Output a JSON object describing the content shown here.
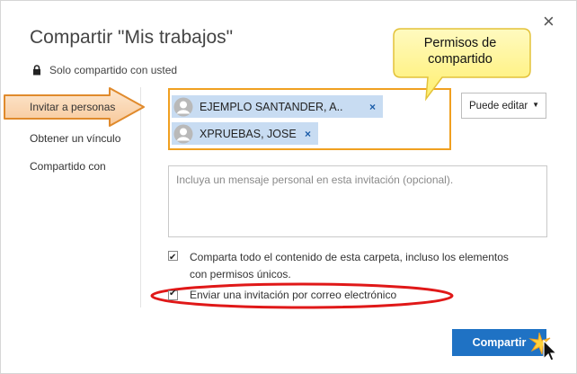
{
  "dialog": {
    "title": "Compartir \"Mis trabajos\"",
    "close_symbol": "×",
    "shared_status": "Solo compartido con usted"
  },
  "nav": {
    "items": [
      {
        "label": "Invitar a personas",
        "active": true
      },
      {
        "label": "Obtener un vínculo",
        "active": false
      },
      {
        "label": "Compartido con",
        "active": false
      }
    ]
  },
  "recipients": [
    {
      "name": "EJEMPLO SANTANDER, A..",
      "remove": "×"
    },
    {
      "name": "XPRUEBAS, JOSE",
      "remove": "×"
    }
  ],
  "permission": {
    "selected": "Puede editar",
    "arrow": "▼"
  },
  "message": {
    "placeholder": "Incluya un mensaje personal en esta invitación (opcional)."
  },
  "options": {
    "share_all": {
      "label": "Comparta todo el contenido de esta carpeta, incluso los elementos con permisos únicos.",
      "checked": true
    },
    "send_email": {
      "label": "Enviar una invitación por correo electrónico",
      "checked": true
    }
  },
  "share_button": {
    "label": "Compartir"
  },
  "callout": {
    "text": "Permisos de compartido"
  },
  "colors": {
    "accent": "#1f72c4",
    "chip": "#c8dcf2",
    "highlight_orange": "#f0a020",
    "highlight_red": "#e01818",
    "callout_fill": "#fff59a"
  },
  "icons": [
    "lock-icon",
    "avatar-icon",
    "remove-icon",
    "close-icon",
    "dropdown-arrow-icon",
    "checkbox-icon",
    "arrow-annotation",
    "cursor-icon"
  ]
}
